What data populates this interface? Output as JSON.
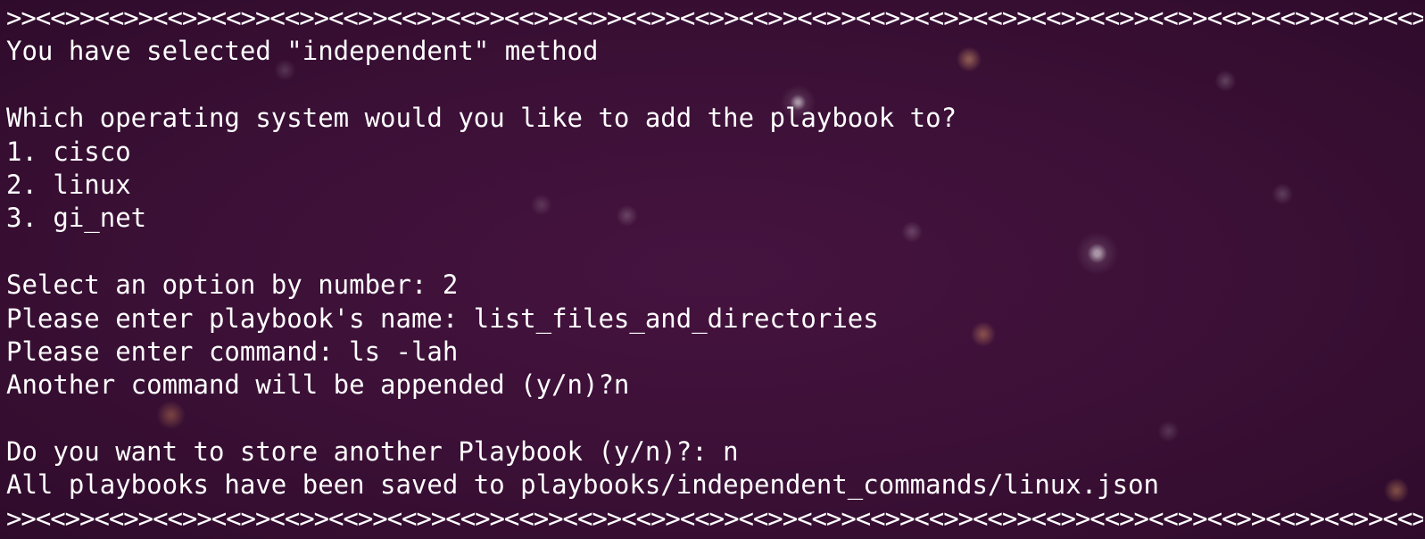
{
  "terminal": {
    "separator": ">><<>><<>><<>><<>><<>><<>><<>><<>><<>><<>><<>><<>><<>><<>><<>><<>><<>><<>><<>><<>><<>><<>><<>><<>><<>><<>><<>><<>><<>><<>><<>><<",
    "selected_method": "You have selected \"independent\" method",
    "os_question": "Which operating system would you like to add the playbook to?",
    "options": [
      "1. cisco",
      "2. linux",
      "3. gi_net"
    ],
    "select_prompt": "Select an option by number: 2",
    "name_prompt": "Please enter playbook's name: list_files_and_directories",
    "command_prompt": "Please enter command: ls -lah",
    "append_prompt": "Another command will be appended (y/n)?n",
    "store_prompt": "Do you want to store another Playbook (y/n)?: n",
    "saved_message": "All playbooks have been saved to playbooks/independent_commands/linux.json"
  }
}
